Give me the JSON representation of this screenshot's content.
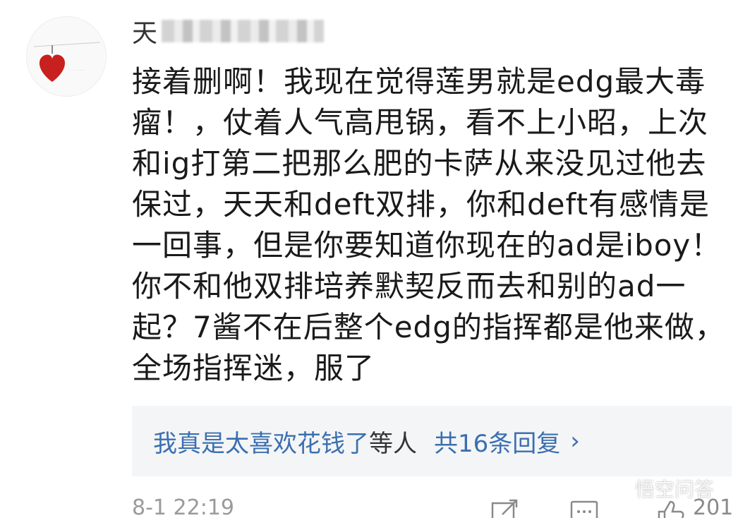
{
  "comment": {
    "username_visible": "天",
    "text": "接着删啊！我现在觉得莲男就是edg最大毒瘤！，仗着人气高甩锅，看不上小昭，上次和ig打第二把那么肥的卡萨从来没见过他去保过，天天和deft双排，你和deft有感情是一回事，但是你要知道你现在的ad是iboy！你不和他双排培养默契反而去和别的ad一起？7酱不在后整个edg的指挥都是他来做，全场指挥迷，服了",
    "avatar_icon": "heart-avatar-icon"
  },
  "replies": {
    "user": "我真是太喜欢花钱了",
    "etc": "等人",
    "count_label": "共16条回复",
    "chevron": "›"
  },
  "footer": {
    "time": "8-1 22:19",
    "like_count": "201",
    "share_icon": "share-icon",
    "comment_icon": "comment-icon",
    "like_icon": "thumbs-up-icon"
  },
  "watermark": {
    "text": "悟空问答"
  },
  "colors": {
    "link_blue": "#3b6fb0",
    "reply_bg": "#f4f5f6",
    "text": "#1a1a1a",
    "muted": "#9a9a9a"
  }
}
